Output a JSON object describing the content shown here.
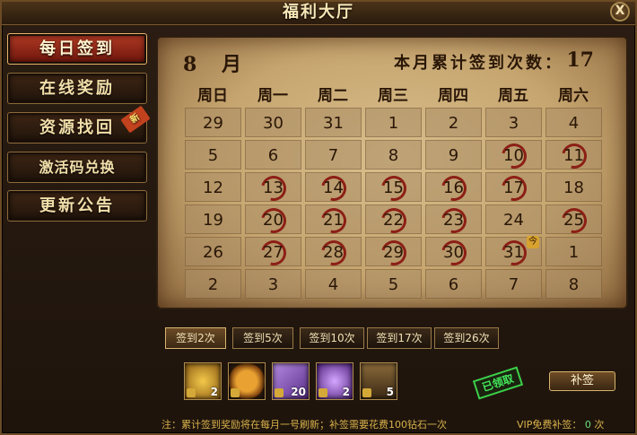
{
  "window": {
    "title": "福利大厅",
    "close_label": "X"
  },
  "menu": [
    {
      "label": "每日签到",
      "active": true,
      "badge": ""
    },
    {
      "label": "在线奖励",
      "active": false,
      "badge": ""
    },
    {
      "label": "资源找回",
      "active": false,
      "badge": "新"
    },
    {
      "label": "激活码兑换",
      "active": false,
      "badge": ""
    },
    {
      "label": "更新公告",
      "active": false,
      "badge": ""
    }
  ],
  "calendar": {
    "month": "8 月",
    "total_label": "本月累计签到次数：",
    "total_count": "17",
    "weekdays": [
      "周日",
      "周一",
      "周二",
      "周三",
      "周四",
      "周五",
      "周六"
    ],
    "weeks": [
      [
        "29",
        "30",
        "31",
        "1",
        "2",
        "3",
        "4"
      ],
      [
        "5",
        "6",
        "7",
        "8",
        "9",
        "10",
        "11"
      ],
      [
        "12",
        "13",
        "14",
        "15",
        "16",
        "17",
        "18"
      ],
      [
        "19",
        "20",
        "21",
        "22",
        "23",
        "24",
        "25"
      ],
      [
        "26",
        "27",
        "28",
        "29",
        "30",
        "31",
        "1"
      ],
      [
        "2",
        "3",
        "4",
        "5",
        "6",
        "7",
        "8"
      ]
    ],
    "signed": [
      [
        false,
        false,
        false,
        false,
        false,
        false,
        false
      ],
      [
        false,
        false,
        false,
        false,
        false,
        true,
        true
      ],
      [
        false,
        true,
        true,
        true,
        true,
        true,
        false
      ],
      [
        false,
        true,
        true,
        true,
        true,
        false,
        true
      ],
      [
        false,
        true,
        true,
        true,
        true,
        true,
        false
      ],
      [
        false,
        false,
        false,
        false,
        false,
        false,
        false
      ]
    ],
    "today_marker": "今"
  },
  "tabs": [
    "签到2次",
    "签到5次",
    "签到10次",
    "签到17次",
    "签到26次"
  ],
  "rewards": [
    {
      "icon": "gold-chest-icon",
      "count": "2"
    },
    {
      "icon": "gold-coin-icon",
      "count": ""
    },
    {
      "icon": "purple-scroll-icon",
      "count": "20"
    },
    {
      "icon": "purple-crystal-icon",
      "count": "2"
    },
    {
      "icon": "treasure-box-icon",
      "count": "5"
    }
  ],
  "claimed_label": "已领取",
  "makeup_button": "补签",
  "note": "注：累计签到奖励将在每月一号刷新；补签需要花费100钻石一次",
  "vip_label": "VIP免费补签：",
  "vip_count": "0",
  "vip_unit": "次",
  "colors": {
    "accent": "#b23a24",
    "parchment": "#c6a56f",
    "signed_ring": "#8c1f16",
    "claimed": "#42e85a"
  }
}
